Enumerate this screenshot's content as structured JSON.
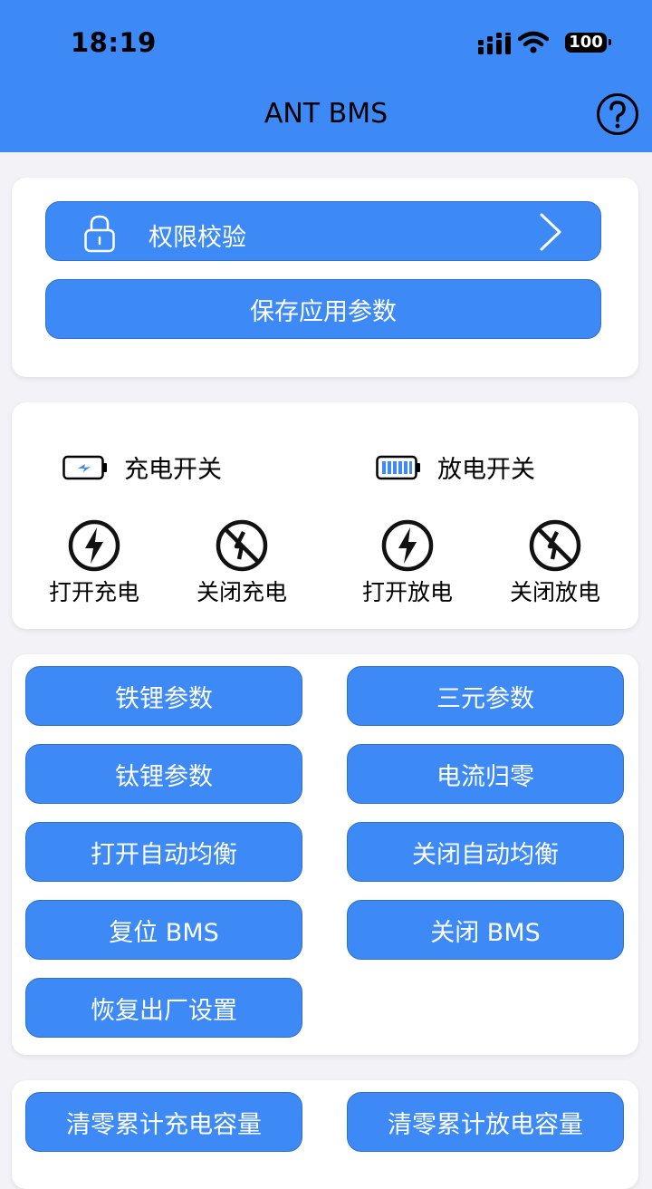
{
  "status_bar": {
    "time": "18:19",
    "battery": "100"
  },
  "nav": {
    "title": "ANT BMS"
  },
  "auth": {
    "label": "权限校验",
    "save_label": "保存应用参数"
  },
  "switches": {
    "charge_label": "充电开关",
    "discharge_label": "放电开关",
    "actions": [
      "打开充电",
      "关闭充电",
      "打开放电",
      "关闭放电"
    ]
  },
  "commands": [
    "铁锂参数",
    "三元参数",
    "钛锂参数",
    "电流归零",
    "打开自动均衡",
    "关闭自动均衡",
    "复位 BMS",
    "关闭 BMS",
    "恢复出厂设置"
  ],
  "clear": [
    "清零累计充电容量",
    "清零累计放电容量"
  ],
  "colors": {
    "accent": "#3d8af7",
    "background": "#f2f2f7"
  }
}
